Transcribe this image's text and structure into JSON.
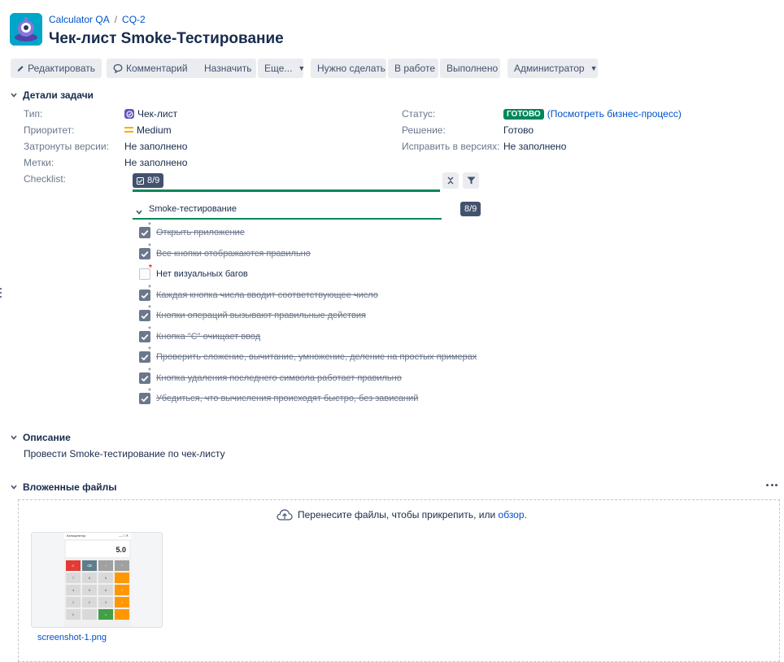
{
  "header": {
    "project": "Calculator QA",
    "issue_key": "CQ-2",
    "title": "Чек-лист Smoke-Тестирование"
  },
  "toolbar": {
    "edit": "Редактировать",
    "comment": "Комментарий",
    "assign": "Назначить",
    "more": "Еще...",
    "todo": "Нужно сделать",
    "in_progress": "В работе",
    "done": "Выполнено",
    "admin": "Администратор"
  },
  "details": {
    "heading": "Детали задачи",
    "type_label": "Тип:",
    "type_value": "Чек-лист",
    "priority_label": "Приоритет:",
    "priority_value": "Medium",
    "affects_label": "Затронуты версии:",
    "affects_value": "Не заполнено",
    "labels_label": "Метки:",
    "labels_value": "Не заполнено",
    "checklist_label": "Checklist:",
    "status_label": "Статус:",
    "status_value": "ГОТОВО",
    "status_link": "(Посмотреть бизнес-процесс)",
    "resolution_label": "Решение:",
    "resolution_value": "Готово",
    "fix_label": "Исправить в версиях:",
    "fix_value": "Не заполнено"
  },
  "checklist": {
    "progress": "8/9",
    "group_name": "Smoke-тестирование",
    "group_progress": "8/9",
    "items": [
      {
        "text": "Открыть приложение",
        "done": true
      },
      {
        "text": "Все кнопки отображаются правильно",
        "done": true
      },
      {
        "text": "Нет визуальных багов",
        "done": false
      },
      {
        "text": "Каждая кнопка числа вводит соответствующее число",
        "done": true
      },
      {
        "text": "Кнопки операций вызывают правильные действия",
        "done": true
      },
      {
        "text": "Кнопка \"C\" очищает ввод",
        "done": true
      },
      {
        "text": "Проверить сложение, вычитание, умножение, деление на простых примерах",
        "done": true
      },
      {
        "text": "Кнопка удаления последнего символа работает правильно",
        "done": true
      },
      {
        "text": "Убедиться, что вычисления происходят быстро, без зависаний",
        "done": true
      }
    ]
  },
  "description": {
    "heading": "Описание",
    "text": "Провести Smoke-тестирование по чек-листу"
  },
  "attachments": {
    "heading": "Вложенные файлы",
    "drop_text": "Перенесите файлы, чтобы прикрепить, или",
    "browse": "обзор",
    "browse_suffix": ".",
    "file_name": "screenshot-1.png",
    "thumb": {
      "window_title": "Калькулятор",
      "display": "5.0",
      "keys": [
        "C",
        "⌫",
        "/",
        "*",
        "7",
        "8",
        "9",
        "-",
        "4",
        "5",
        "6",
        "+",
        "1",
        "2",
        "3",
        "=",
        "0",
        ".",
        "=",
        ""
      ]
    }
  },
  "colors": {
    "accent": "#0052cc",
    "status_done": "#00875a",
    "type_purple": "#6554c0",
    "priority_medium": "#ffab00"
  }
}
